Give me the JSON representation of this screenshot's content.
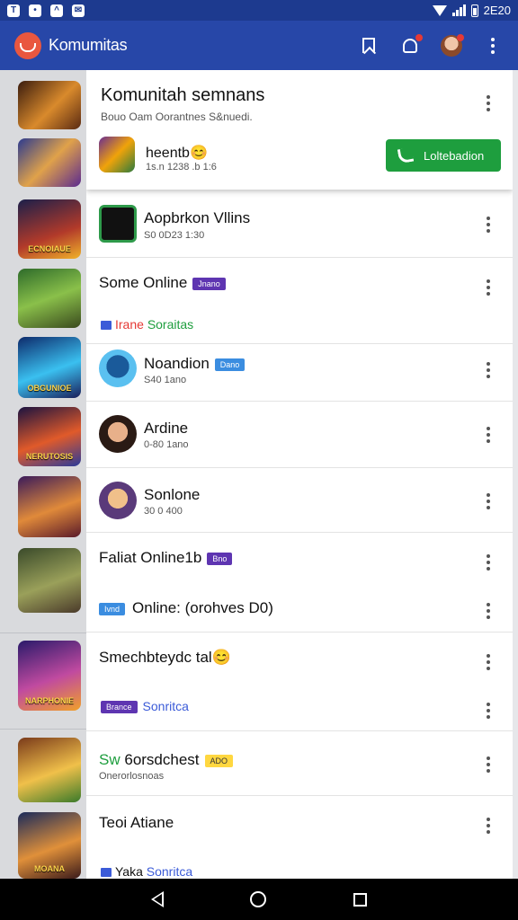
{
  "status_bar": {
    "time": "2E20",
    "left_icons": [
      "T",
      "•",
      "^",
      "✉"
    ]
  },
  "app_bar": {
    "title": "Komumitas"
  },
  "icons": [
    "app-logo-icon",
    "bookmark-icon",
    "notification-bell-icon",
    "profile-avatar-icon",
    "overflow-menu-icon",
    "phone-icon",
    "back-icon",
    "home-icon",
    "recents-icon"
  ],
  "colors": {
    "app_bar": "#2747a8",
    "status_bar": "#1d3a8f",
    "call_button": "#1e9e3e",
    "badge_purple": "#5e35b1",
    "badge_blue": "#3b8de0",
    "section_red": "#e53935",
    "section_green": "#1e9e3e"
  },
  "header_card": {
    "title": "Komunitah semnans",
    "subtitle": "Bouo Oam Oorantnes S&nuedi.",
    "game_name": "heentb😊",
    "game_meta": "1s.n 1238 .b 1:6",
    "call_label": "Loltebadion"
  },
  "rows": [
    {
      "name": "Aopbrkon Vllins",
      "meta": "S0 0D23 1:30"
    },
    {
      "name": "Some Online",
      "badge": "Jnano"
    },
    {
      "section": "Irane",
      "section_rest": "Soraitas"
    },
    {
      "name": "Noandion",
      "badge": "Dano",
      "meta": "S40 1ano"
    },
    {
      "name": "Ardine",
      "meta": "0-80 1ano"
    },
    {
      "name": "Sonlone",
      "meta": "30 0 400"
    },
    {
      "name": "Faliat Online1b",
      "badge": "Bno"
    },
    {
      "tag": "Ivnd",
      "name": "Online: (orohves D0)"
    },
    {
      "name": "Smechbteydc tal😊"
    },
    {
      "tag": "Brance",
      "section": "Sonritca"
    },
    {
      "name_green": "Sw",
      "name": "6orsdchest",
      "badge": "ADO",
      "meta": "Onerorlosnoas"
    },
    {
      "name": "Teoi Atiane"
    },
    {
      "tag": "Yaka",
      "section": "Sonritca"
    }
  ],
  "strip_labels": [
    "ECNOIAUE",
    "OBGUNIOE",
    "NERUTOSIS",
    "MOANA",
    "NARPHONIE"
  ]
}
